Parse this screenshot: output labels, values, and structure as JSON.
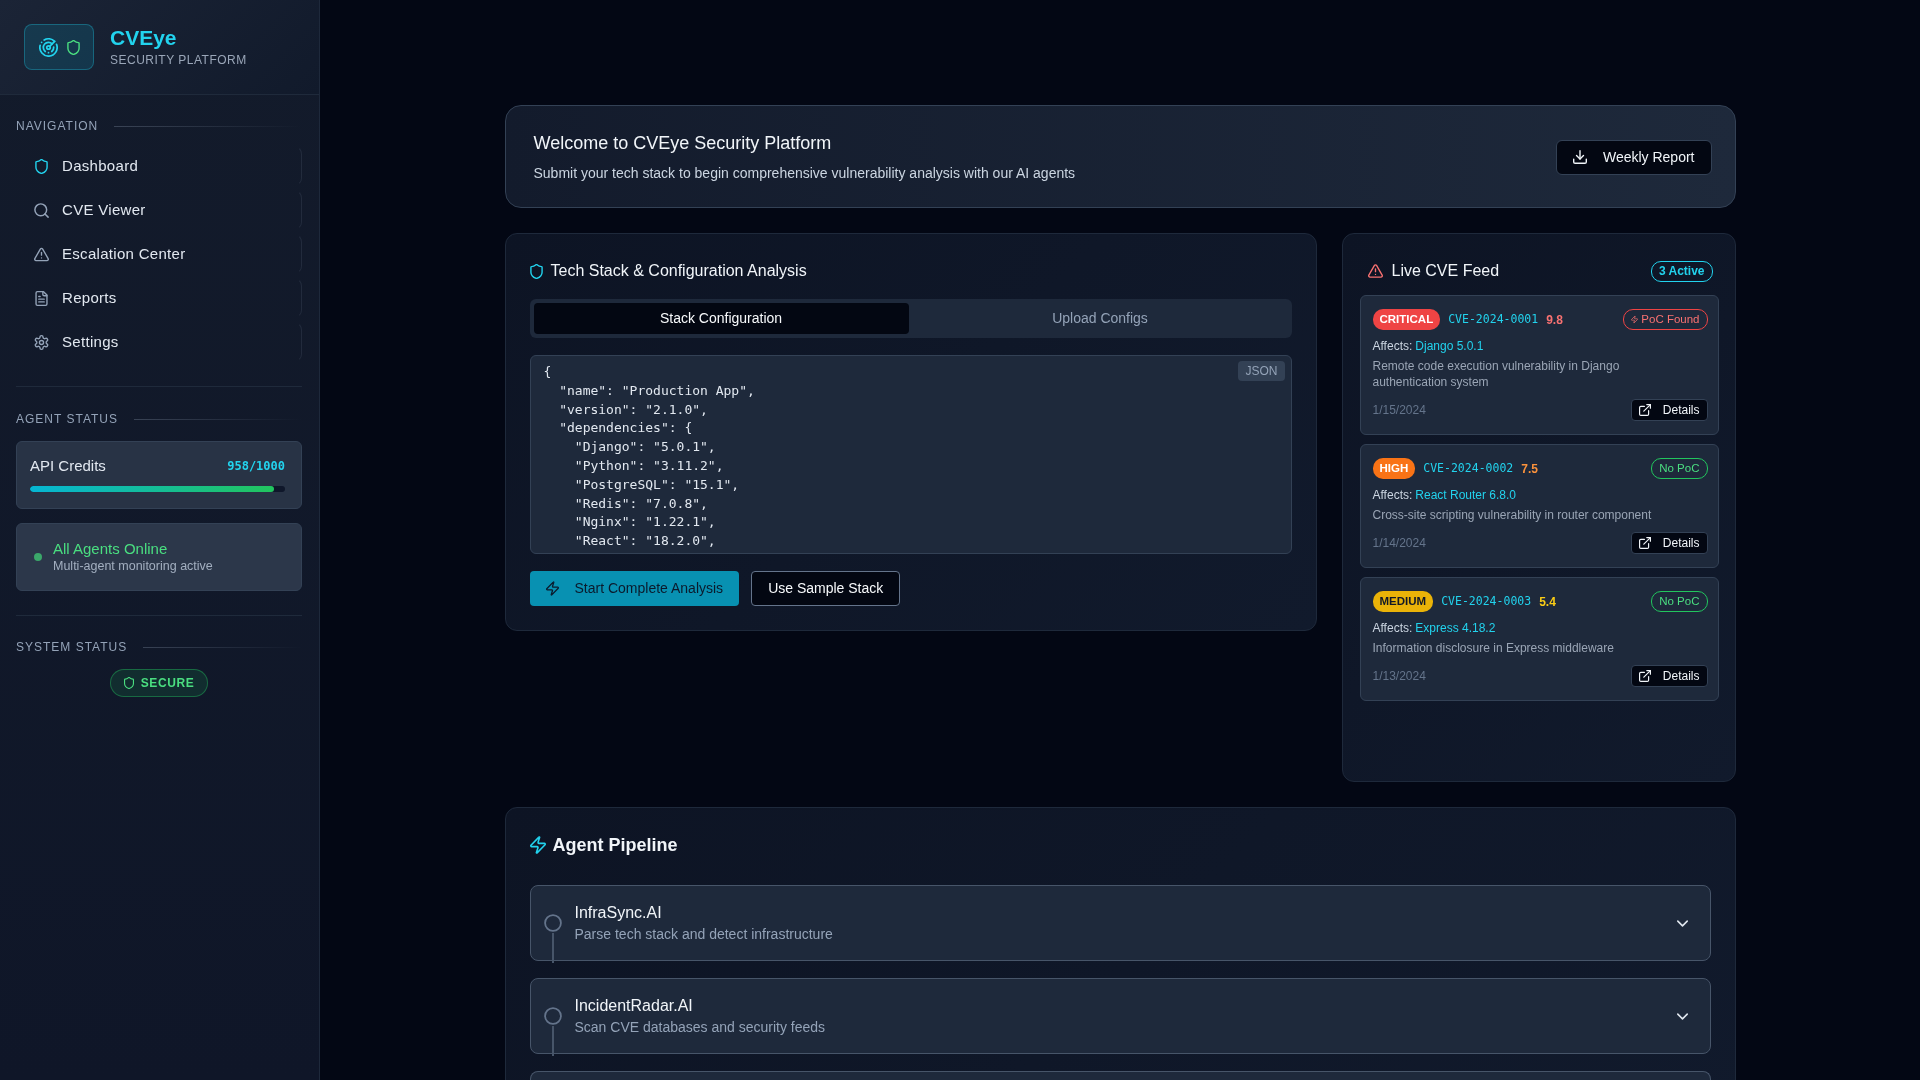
{
  "sidebar": {
    "brand": {
      "title": "CVEye",
      "subtitle": "SECURITY PLATFORM"
    },
    "navigation": {
      "heading": "NAVIGATION",
      "items": [
        {
          "label": "Dashboard",
          "selected": true
        },
        {
          "label": "CVE Viewer",
          "selected": false
        },
        {
          "label": "Escalation Center",
          "selected": false
        },
        {
          "label": "Reports",
          "selected": false
        },
        {
          "label": "Settings",
          "selected": false
        }
      ]
    },
    "agent_status": {
      "heading": "AGENT STATUS",
      "api_credits": {
        "label": "API Credits",
        "reading": "958/1000",
        "level": 0.958
      },
      "agents": {
        "title": "All Agents Online",
        "subtitle": "Multi-agent monitoring active"
      }
    },
    "system_status": {
      "heading": "SYSTEM STATUS",
      "badge": "SECURE"
    }
  },
  "welcome": {
    "title": "Welcome to CVEye Security Platform",
    "subtitle": "Submit your tech stack to begin comprehensive vulnerability analysis with our AI agents",
    "button": "Weekly Report"
  },
  "tech_stack": {
    "title": "Tech Stack & Configuration Analysis",
    "tabs": [
      {
        "label": "Stack Configuration",
        "selected": true
      },
      {
        "label": "Upload Configs",
        "selected": false
      }
    ],
    "editor": {
      "badge": "JSON",
      "value": "{\n  \"name\": \"Production App\",\n  \"version\": \"2.1.0\",\n  \"dependencies\": {\n    \"Django\": \"5.0.1\",\n    \"Python\": \"3.11.2\",\n    \"PostgreSQL\": \"15.1\",\n    \"Redis\": \"7.0.8\",\n    \"Nginx\": \"1.22.1\",\n    \"React\": \"18.2.0\","
    },
    "buttons": [
      {
        "label": "Start Complete Analysis",
        "kind": "primary"
      },
      {
        "label": "Use Sample Stack",
        "kind": "outline"
      }
    ]
  },
  "cve_feed": {
    "title": "Live CVE Feed",
    "badge": "3 Active",
    "items": [
      {
        "severity": "CRITICAL",
        "kind": "critical",
        "id": "CVE-2024-0001",
        "score": "9.8",
        "poc_found": true,
        "poc": "PoC Found",
        "affects_label": "Affects:",
        "affects": "Django 5.0.1",
        "description": "Remote code execution vulnerability in Django authentication system",
        "date": "1/15/2024",
        "button": "Details"
      },
      {
        "severity": "HIGH",
        "kind": "high",
        "id": "CVE-2024-0002",
        "score": "7.5",
        "poc_found": false,
        "poc": "No PoC",
        "affects_label": "Affects:",
        "affects": "React Router 6.8.0",
        "description": "Cross-site scripting vulnerability in router component",
        "date": "1/14/2024",
        "button": "Details"
      },
      {
        "severity": "MEDIUM",
        "kind": "medium",
        "id": "CVE-2024-0003",
        "score": "5.4",
        "poc_found": false,
        "poc": "No PoC",
        "affects_label": "Affects:",
        "affects": "Express 4.18.2",
        "description": "Information disclosure in Express middleware",
        "date": "1/13/2024",
        "button": "Details"
      }
    ]
  },
  "pipeline": {
    "title": "Agent Pipeline",
    "steps": [
      {
        "name": "InfraSync.AI",
        "description": "Parse tech stack and detect infrastructure"
      },
      {
        "name": "IncidentRadar.AI",
        "description": "Scan CVE databases and security feeds"
      }
    ]
  }
}
